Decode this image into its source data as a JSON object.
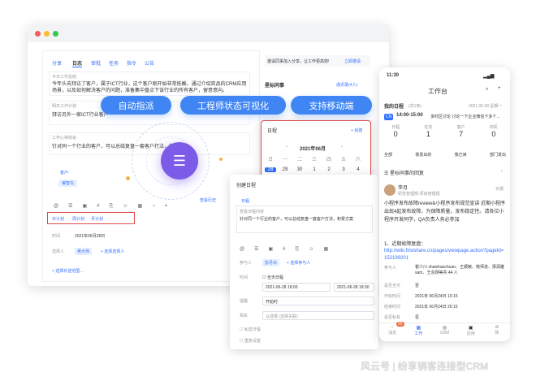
{
  "desktop": {
    "tabs": [
      "分享",
      "日志",
      "审批",
      "任务",
      "指令",
      "公告"
    ],
    "log_fields": [
      {
        "label": "今天工作总结",
        "value": "今年头去拜访了客户，属于ICT行业，这个客户刚开始非常抵触，通过介绍奕品的CRM应用场景，以及如何解决客户的问题，准备集中盘点下该行业的所有客户，留意意向。"
      },
      {
        "label": "明日工作计划",
        "value": "拜访另外一家ICT行业客户"
      },
      {
        "label": "工作心得体会",
        "value": "针对同一个行业的客户，可以总结复盘一套客户打法，积累方案"
      }
    ],
    "customer_label": "客户:",
    "customer_tag": "睿智鸟",
    "view_history": "查看历史",
    "plan_tabs": [
      "日计划",
      "周计划",
      "月计划"
    ],
    "time_label": "时间",
    "time_value": "2021年06月28日",
    "send_to_label": "选择人",
    "send_person": "吴大伟",
    "add_person": "+ 选择选择人",
    "add_more": "+ 选择补送范围...",
    "invite_text": "邀请同事加入分享，让工作更高效!",
    "invite_link": "立即邀请",
    "star_title": "星标同事",
    "star_count": "通讯录(4人)",
    "cal_title": "日程",
    "cal_new": "+ 创建",
    "cal_month": "2021年06月",
    "cal_weekdays": [
      "日",
      "一",
      "二",
      "三",
      "四",
      "五",
      "六"
    ],
    "cal_days": [
      "28",
      "29",
      "30",
      "1",
      "2",
      "3",
      "4"
    ],
    "pills": [
      "自动指派",
      "工程师状态可视化",
      "支持移动端"
    ]
  },
  "schedule_dialog": {
    "title": "创建日程",
    "label": "日程",
    "placeholder": "查看日程内容",
    "content": "针对同一个行业的客户，可以总结复盘一套客户打法，积累方案",
    "participants_label": "参与人",
    "participant": "彭丹冰",
    "add_participant": "+ 选择参与人",
    "time_label": "时间",
    "allday": "全天日程",
    "start": "2021-06-28 18:00",
    "end": "2021-06-28 18:30",
    "remind_label": "提醒",
    "remind_value": "开始时",
    "relate_label": "相关",
    "relate_value": "从选择 (选择关联)",
    "private": "私密日程",
    "repeat": "重复设置"
  },
  "phone": {
    "time": "11:30",
    "title": "工作台",
    "my_schedule": "我的日程",
    "count": "(共1条)",
    "date": "2021.06.28 星期一",
    "event_time": "14:00-15:00",
    "event_text": "多时区讨论 讨论一下企业微信下多个...",
    "stats": [
      {
        "label": "日程",
        "value": "0"
      },
      {
        "label": "任务",
        "value": "1"
      },
      {
        "label": "客户",
        "value": "7"
      },
      {
        "label": "商机",
        "value": "0"
      }
    ],
    "filters": [
      "全部",
      "我发出的",
      "我已读",
      "部门发出"
    ],
    "star_reply": "星标同事的回复",
    "poster": "李月",
    "poster_dept": "研发管理部-项目管理组",
    "badge": "日报",
    "post_text": "小程序发布故障review&小程序发布规范宣讲 近期小程序出现4起发布故障，为保障质量，发布稳定性。请各位小程序开发同学，QA负责人务必参加",
    "section": "1、近期故障复盘：",
    "link": "http://wiki.firstshare.cn/pages/viewpage.action?pageId=152199201",
    "rows": [
      {
        "k": "参与人",
        "v": "翟少川 zhaishaochuan、王顺敏、熊师进、梁润雄 sam、王永刚等共 44 人"
      },
      {
        "k": "是否全天",
        "v": "否"
      },
      {
        "k": "开始时间",
        "v": "2021年 06月24日 19:15"
      },
      {
        "k": "结束时间",
        "v": "2021年 06月24日 20:15"
      },
      {
        "k": "是否私有",
        "v": "否"
      }
    ],
    "tabbar": [
      "消息",
      "工作",
      "CRM",
      "应用",
      "我"
    ],
    "tab_badge": "99"
  },
  "watermark": "风云号 | 纷享销客连接型CRM",
  "colors": {
    "accent": "#3370ff",
    "pill": "#3f86f4",
    "purple": "#7b5be8",
    "red": "#e04b4b"
  }
}
